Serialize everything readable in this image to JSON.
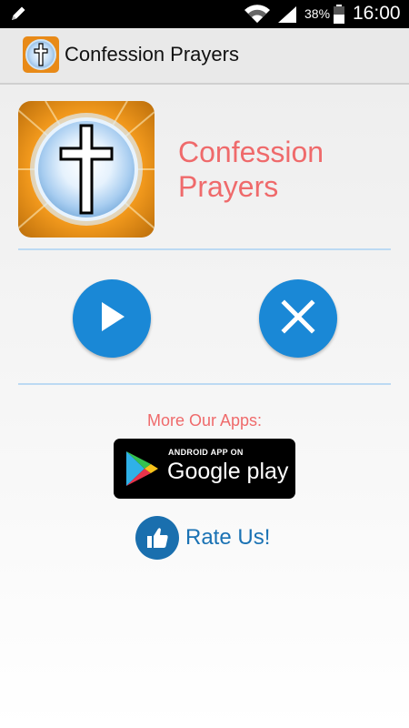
{
  "status_bar": {
    "battery_percent": "38%",
    "time": "16:00",
    "icons": [
      "pencil-icon",
      "wifi-icon",
      "signal-icon",
      "battery-icon"
    ]
  },
  "action_bar": {
    "title": "Confession Prayers",
    "icon": "cross-app-icon"
  },
  "header": {
    "headline_line1": "Confession",
    "headline_line2": "Prayers"
  },
  "controls": {
    "play_icon": "play-icon",
    "close_icon": "close-icon"
  },
  "promo": {
    "more_apps_label": "More Our Apps:",
    "store_badge_top": "ANDROID APP ON",
    "store_badge_main": "Google play",
    "rate_label": "Rate Us!"
  },
  "colors": {
    "accent_blue": "#1a88d6",
    "headline_red": "#ef6a6b",
    "divider": "#bcdaf3",
    "rate_blue": "#1a72b4"
  }
}
